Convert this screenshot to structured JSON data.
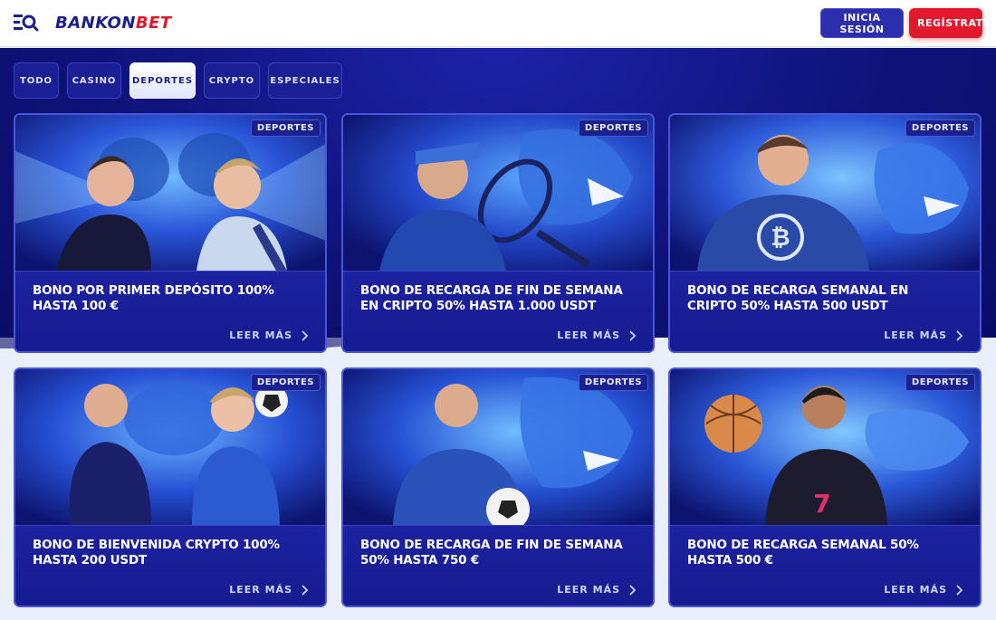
{
  "header": {
    "logo_part1": "BANKON",
    "logo_part2": "BET",
    "login_label": "INICIA SESIÓN",
    "register_label": "REGÍSTRATE"
  },
  "tabs": [
    {
      "label": "TODO"
    },
    {
      "label": "CASINO"
    },
    {
      "label": "DEPORTES",
      "active": true
    },
    {
      "label": "CRYPTO"
    },
    {
      "label": "ESPECIALES"
    }
  ],
  "cards": [
    {
      "badge": "DEPORTES",
      "title": "BONO POR PRIMER DEPÓSITO 100% HASTA 100 €",
      "cta": "LEER MÁS"
    },
    {
      "badge": "DEPORTES",
      "title": "BONO DE RECARGA DE FIN DE SEMANA EN CRIPTO 50% HASTA 1.000 USDT",
      "cta": "LEER MÁS"
    },
    {
      "badge": "DEPORTES",
      "title": "BONO DE RECARGA SEMANAL EN CRIPTO 50% HASTA 500 USDT",
      "cta": "LEER MÁS"
    },
    {
      "badge": "DEPORTES",
      "title": "BONO DE BIENVENIDA CRYPTO 100% HASTA 200 USDT",
      "cta": "LEER MÁS"
    },
    {
      "badge": "DEPORTES",
      "title": "BONO DE RECARGA DE FIN DE SEMANA 50% HASTA 750 €",
      "cta": "LEER MÁS"
    },
    {
      "badge": "DEPORTES",
      "title": "BONO DE RECARGA SEMANAL 50% HASTA 500 €",
      "cta": "LEER MÁS"
    }
  ],
  "colors": {
    "brand_navy": "#1a1f8a",
    "brand_red": "#e0172b",
    "background_blue": "#0f1379",
    "card_border": "#4a55d9"
  },
  "icons": [
    "menu-search-icon",
    "chevron-right-icon"
  ]
}
